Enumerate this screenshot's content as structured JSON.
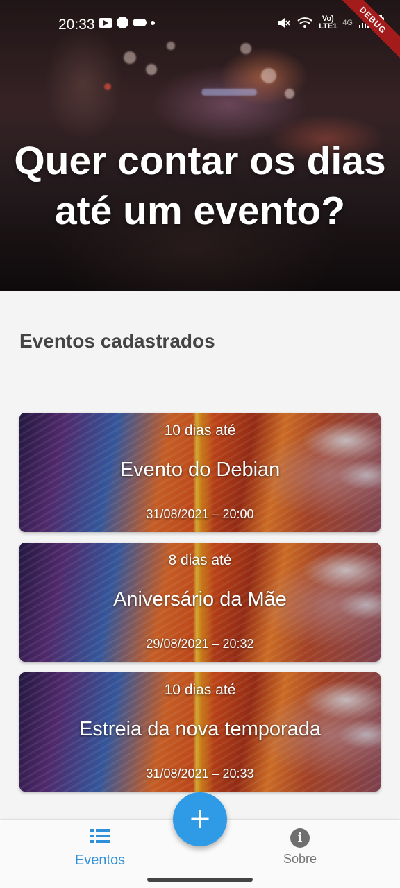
{
  "status_bar": {
    "time": "20:33",
    "network_top": "Vo)",
    "network_bottom": "LTE1",
    "network_type": "4G",
    "debug_banner": "DEBUG"
  },
  "hero": {
    "title_line1": "Quer contar os dias",
    "title_line2": "até um evento?"
  },
  "section": {
    "title": "Eventos cadastrados"
  },
  "events": [
    {
      "days_label": "10 dias até",
      "name": "Evento do Debian",
      "datetime": "31/08/2021 – 20:00"
    },
    {
      "days_label": "8 dias até",
      "name": "Aniversário da Mãe",
      "datetime": "29/08/2021 – 20:32"
    },
    {
      "days_label": "10 dias até",
      "name": "Estreia da nova temporada",
      "datetime": "31/08/2021 – 20:33"
    }
  ],
  "fab": {
    "icon": "plus-icon",
    "symbol": "+"
  },
  "bottom_nav": {
    "items": [
      {
        "label": "Eventos",
        "icon": "list-icon",
        "active": true
      },
      {
        "label": "Sobre",
        "icon": "info-icon",
        "active": false
      }
    ],
    "active_color": "#2f8fd8"
  }
}
